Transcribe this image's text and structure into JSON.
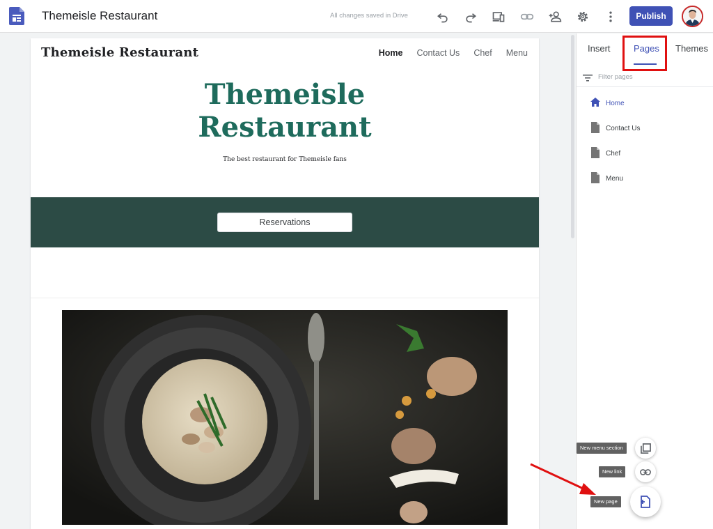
{
  "app": {
    "title": "Themeisle Restaurant",
    "save_status": "All changes saved in Drive",
    "publish_label": "Publish",
    "icons": [
      "google-sites-icon",
      "undo-icon",
      "redo-icon",
      "preview-devices-icon",
      "link-icon",
      "share-add-person-icon",
      "settings-gear-icon",
      "more-vert-icon"
    ],
    "accent_color": "#3f51b5"
  },
  "site": {
    "brand": "Themeisle Restaurant",
    "nav": [
      "Home",
      "Contact Us",
      "Chef",
      "Menu"
    ],
    "hero_title_line1": "Themeisle",
    "hero_title_line2": "Restaurant",
    "hero_subtitle": "The best restaurant for Themeisle fans",
    "reservations_label": "Reservations",
    "band_color": "#2c4b45",
    "title_color": "#1e6b5c"
  },
  "panel": {
    "tabs": [
      "Insert",
      "Pages",
      "Themes"
    ],
    "active_tab": "Pages",
    "filter_placeholder": "Filter pages",
    "pages": [
      "Home",
      "Contact Us",
      "Chef",
      "Menu"
    ],
    "fab_tooltips": {
      "new_menu_section": "New menu section",
      "new_link": "New link",
      "new_page": "New page"
    },
    "highlight_color": "#e01010"
  }
}
